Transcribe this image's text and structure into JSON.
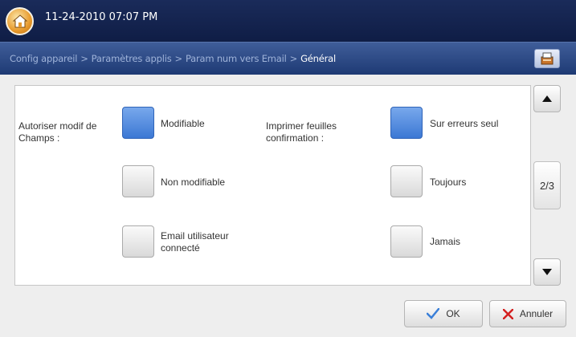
{
  "header": {
    "datetime": "11-24-2010 07:07 PM",
    "home_icon": "home-icon"
  },
  "breadcrumb": {
    "items": [
      "Config appareil",
      "Paramètres applis",
      "Param num vers Email"
    ],
    "current": "Général",
    "separator": ">"
  },
  "settings": {
    "left": {
      "label_line1": "Autoriser modif de",
      "label_line2": "Champs :",
      "options": [
        {
          "line1": "Modifiable",
          "line2": "",
          "selected": true
        },
        {
          "line1": "Non modifiable",
          "line2": "",
          "selected": false
        },
        {
          "line1": "Email utilisateur",
          "line2": "connecté",
          "selected": false
        }
      ]
    },
    "right": {
      "label_line1": "Imprimer feuilles",
      "label_line2": "confirmation :",
      "options": [
        {
          "line1": "Sur erreurs seul",
          "line2": "",
          "selected": true
        },
        {
          "line1": "Toujours",
          "line2": "",
          "selected": false
        },
        {
          "line1": "Jamais",
          "line2": "",
          "selected": false
        }
      ]
    }
  },
  "pager": {
    "page": "2/3"
  },
  "actions": {
    "ok_label": "OK",
    "cancel_label": "Annuler"
  },
  "colors": {
    "selected": "#4a84dc",
    "header": "#0f1d45",
    "ok_check": "#3a7fd8",
    "cancel_x": "#d42020"
  }
}
